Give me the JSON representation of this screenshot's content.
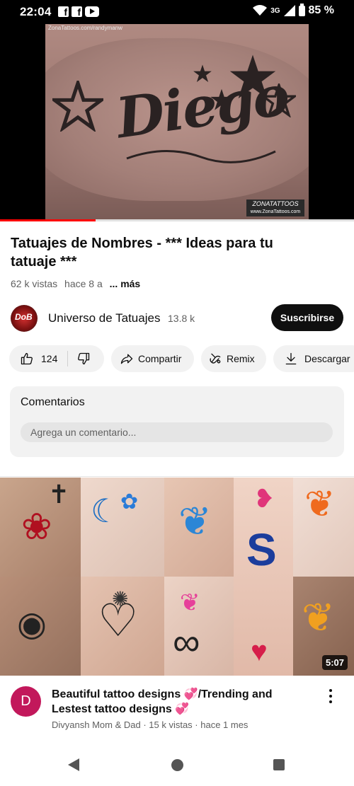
{
  "status_bar": {
    "time": "22:04",
    "network": "3G",
    "battery": "85 %"
  },
  "video": {
    "watermark": "ZonaTattoos.com/randymanw",
    "tattoo_text": "Diego",
    "logo_text": "ZONATATTOOS",
    "logo_sub": "www.ZonaTattoos.com",
    "progress_fraction": 0.27
  },
  "details": {
    "title": "Tatuajes de Nombres - *** Ideas para tu tatuaje ***",
    "views": "62 k vistas",
    "age": "hace 8 a",
    "more": "... más"
  },
  "channel": {
    "avatar_text": "DoB",
    "name": "Universo de Tatuajes",
    "subscribers": "13.8 k",
    "subscribe_label": "Suscribirse"
  },
  "actions": {
    "likes": "124",
    "share": "Compartir",
    "remix": "Remix",
    "download": "Descargar"
  },
  "comments": {
    "title": "Comentarios",
    "placeholder": "Agrega un comentario..."
  },
  "recommended": {
    "duration": "5:07",
    "avatar_letter": "D",
    "title_part1": "Beautiful tattoo designs ",
    "title_part2": "/Trending and Lestest tattoo designs ",
    "meta": "Divyansh Mom & Dad · 15 k vistas · hace 1 mes"
  }
}
